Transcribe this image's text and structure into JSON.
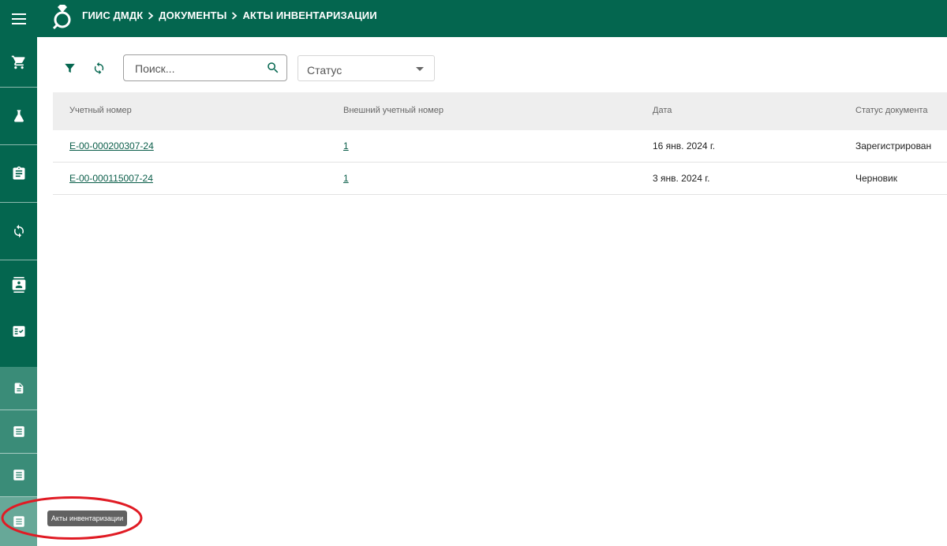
{
  "header": {
    "breadcrumb": [
      "ГИИС ДМДК",
      "ДОКУМЕНТЫ",
      "АКТЫ ИНВЕНТАРИЗАЦИИ"
    ]
  },
  "sidebar": {
    "icons": [
      "cart-icon",
      "flask-icon",
      "clipboard-icon",
      "sync-icon",
      "contact-card-icon",
      "checklist-icon",
      "document-icon",
      "list-document-icon",
      "list-document-icon",
      "list-document-icon"
    ],
    "tooltip": "Акты инвентаризации"
  },
  "toolbar": {
    "search_placeholder": "Поиск...",
    "status_label": "Статус"
  },
  "table": {
    "columns": [
      "Учетный номер",
      "Внешний учетный номер",
      "Дата",
      "Статус документа"
    ],
    "rows": [
      [
        "E-00-000200307-24",
        "1",
        "16 янв. 2024 г.",
        "Зарегистрирован"
      ],
      [
        "E-00-000115007-24",
        "1",
        "3 янв. 2024 г.",
        "Черновик"
      ]
    ]
  },
  "colors": {
    "brand": "#04664f",
    "sidebar_light": "#3a8c78",
    "annotation": "#e01b24"
  }
}
